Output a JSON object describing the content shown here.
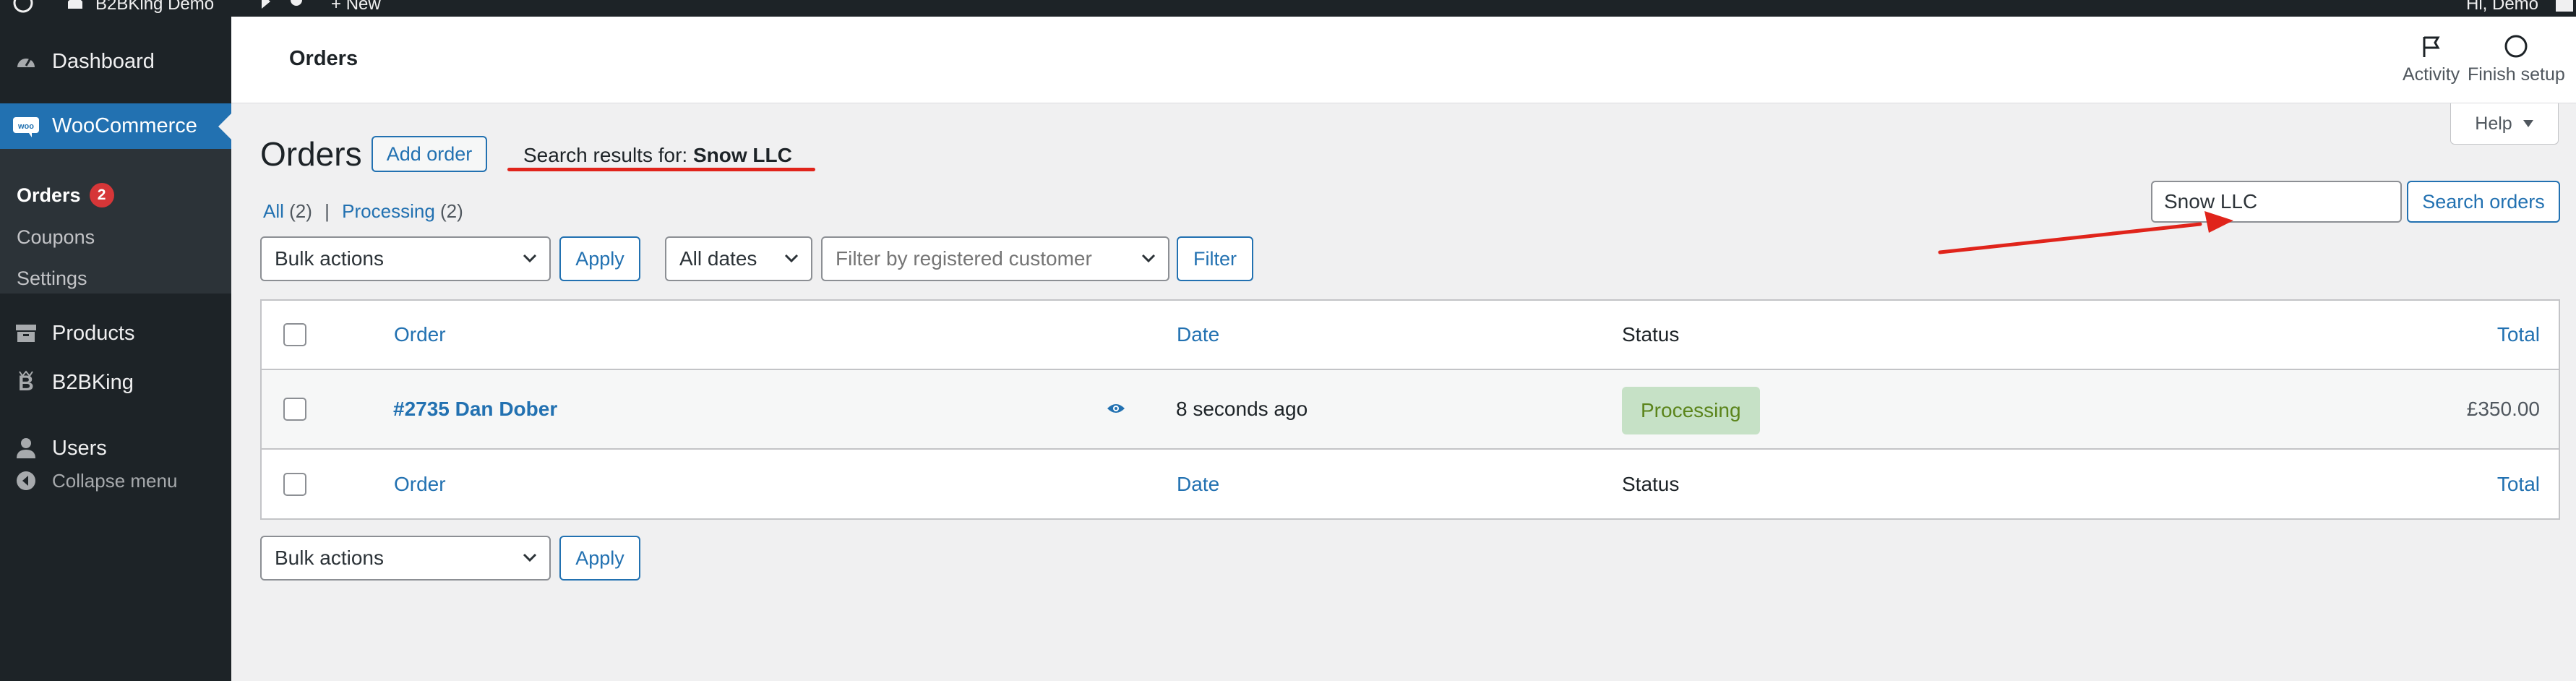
{
  "admin_bar": {
    "site_name": "B2BKing Demo",
    "new_label": "New",
    "greeting": "Hi, Demo"
  },
  "sidebar": {
    "items": [
      {
        "label": "Dashboard",
        "icon": "dashboard-icon"
      },
      {
        "label": "WooCommerce",
        "icon": "woo-icon",
        "active": true
      },
      {
        "label": "Products",
        "icon": "products-icon"
      },
      {
        "label": "B2BKing",
        "icon": "b2bking-icon"
      },
      {
        "label": "Users",
        "icon": "users-icon"
      },
      {
        "label": "Collapse menu",
        "icon": "collapse-icon"
      }
    ],
    "submenu": [
      {
        "label": "Orders",
        "badge": "2",
        "current": true
      },
      {
        "label": "Coupons"
      },
      {
        "label": "Settings"
      }
    ]
  },
  "header": {
    "title": "Orders",
    "activity_label": "Activity",
    "finish_setup_label": "Finish setup"
  },
  "help": {
    "label": "Help"
  },
  "main": {
    "heading": "Orders",
    "add_order_label": "Add order",
    "search_results_prefix": "Search results for: ",
    "search_results_term": "Snow LLC",
    "views": {
      "all_label": "All",
      "all_count": "(2)",
      "separator": "|",
      "processing_label": "Processing",
      "processing_count": "(2)"
    },
    "bulk_actions": "Bulk actions",
    "apply_label": "Apply",
    "date_filter": "All dates",
    "customer_filter_placeholder": "Filter by registered customer",
    "filter_label": "Filter",
    "search_value": "Snow LLC",
    "search_button_label": "Search orders"
  },
  "table": {
    "columns": {
      "order": "Order",
      "date": "Date",
      "status": "Status",
      "total": "Total"
    },
    "rows": [
      {
        "order": "#2735 Dan Dober",
        "date": "8 seconds ago",
        "status": "Processing",
        "total": "£350.00"
      }
    ]
  },
  "colors": {
    "accent": "#2271b1",
    "sidebar_bg": "#1d2327",
    "status_processing_bg": "#c6e1c6",
    "status_processing_text": "#5b841b",
    "annotation": "#e0241b",
    "badge": "#d63638"
  }
}
